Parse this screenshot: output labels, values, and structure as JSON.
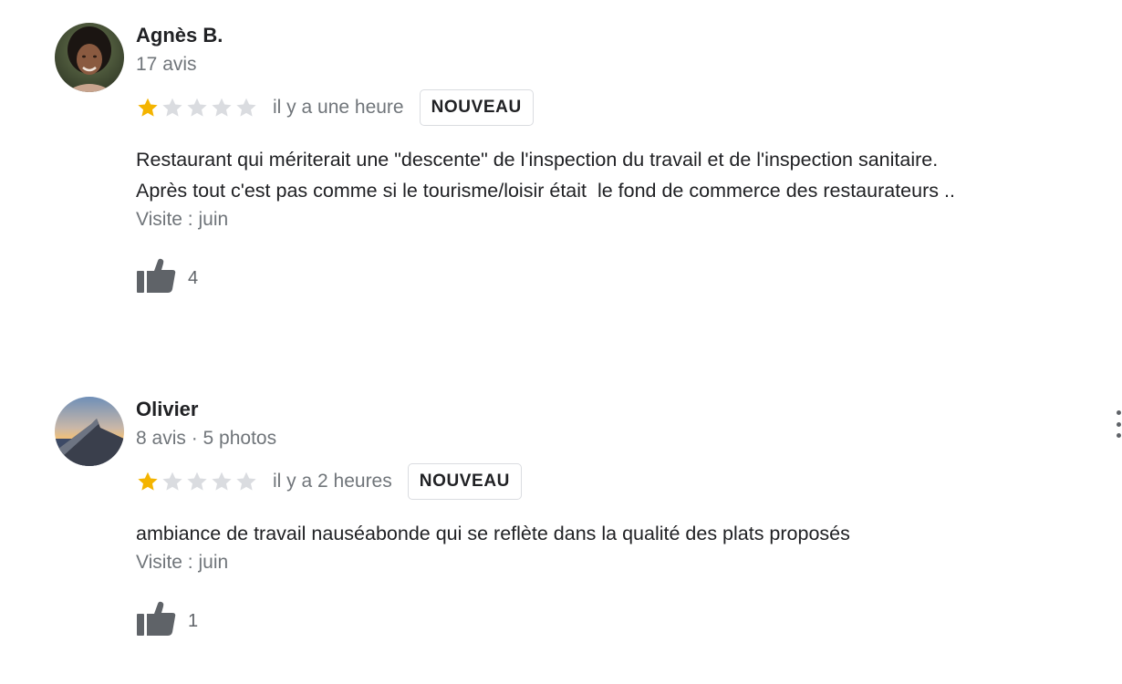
{
  "colors": {
    "star_filled": "#f4b400",
    "star_empty": "#dadce0",
    "secondary_text": "#70757a",
    "thumb_icon": "#5f6368"
  },
  "reviews": [
    {
      "name": "Agnès B.",
      "meta": "17 avis",
      "rating": 1,
      "max_rating": 5,
      "time": "il y a une heure",
      "badge": "NOUVEAU",
      "text": "Restaurant qui mériterait une \"descente\" de l'inspection du travail et de l'inspection sanitaire.\nAprès tout c'est pas comme si le tourisme/loisir était  le fond de commerce des restaurateurs ..",
      "visit": "Visite : juin",
      "likes": "4",
      "avatar_icon": "person-photo-avatar",
      "like_icon": "thumbs-up-icon"
    },
    {
      "name": "Olivier",
      "meta": "8 avis · 5 photos",
      "rating": 1,
      "max_rating": 5,
      "time": "il y a 2 heures",
      "badge": "NOUVEAU",
      "text": "ambiance de travail nauséabonde qui se reflète dans la qualité des plats proposés",
      "visit": "Visite : juin",
      "likes": "1",
      "avatar_icon": "airplane-wing-sunset-avatar",
      "like_icon": "thumbs-up-icon"
    }
  ],
  "more_options_icon": "more-vert-icon"
}
